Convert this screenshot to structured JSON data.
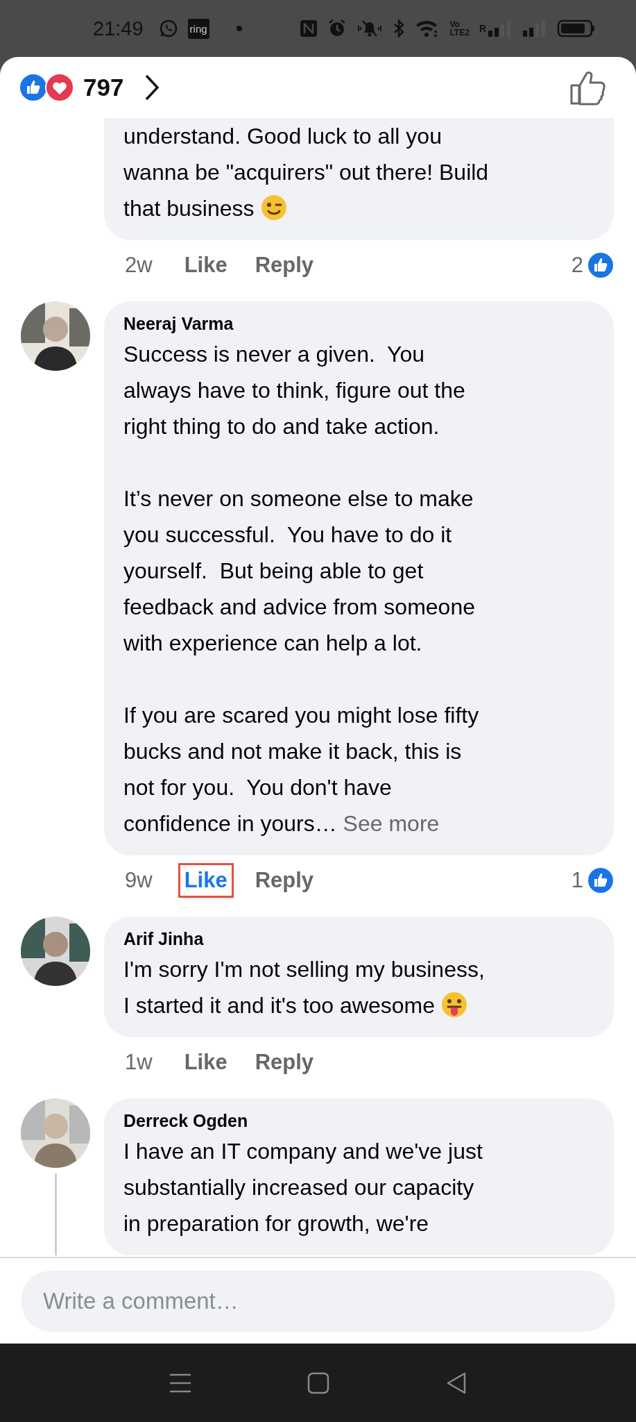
{
  "status_bar": {
    "time": "21:49",
    "app_label": "ring",
    "volte_top": "Vo",
    "volte_bottom": "LTE2",
    "roaming": "R"
  },
  "reactions": {
    "count": "797"
  },
  "comments": [
    {
      "kind": "partial",
      "paragraphs": [
        "understand. Good luck to all you\nwanna be \"acquirers\" out there! Build\nthat business"
      ],
      "emoji": {
        "kind": "wink"
      },
      "time": "2w",
      "like": {
        "label": "Like",
        "liked": false,
        "highlighted": false
      },
      "reply": "Reply",
      "reaction_count": "2"
    },
    {
      "kind": "full",
      "author": "Neeraj Varma",
      "paragraphs": [
        "Success is never a given.  You\nalways have to think, figure out the\nright thing to do and take action.",
        "It’s never on someone else to make\nyou successful.  You have to do it\nyourself.  But being able to get\nfeedback and advice from someone\nwith experience can help a lot.",
        "If you are scared you might lose fifty\nbucks and not make it back, this is\nnot for you.  You don't have\nconfidence in yours… "
      ],
      "see_more": "See more",
      "time": "9w",
      "like": {
        "label": "Like",
        "liked": true,
        "highlighted": true
      },
      "reply": "Reply",
      "reaction_count": "1"
    },
    {
      "kind": "full",
      "author": "Arif Jinha",
      "paragraphs": [
        "I'm sorry I'm not selling my business,\nI started it and it's too awesome"
      ],
      "emoji": {
        "kind": "tongue"
      },
      "time": "1w",
      "like": {
        "label": "Like",
        "liked": false,
        "highlighted": false
      },
      "reply": "Reply"
    },
    {
      "kind": "full",
      "author": "Derreck Ogden",
      "paragraphs": [
        "I have an IT company and we've just\nsubstantially increased our capacity\nin preparation for growth, we're"
      ],
      "has_replies": true
    }
  ],
  "composer": {
    "placeholder": "Write a comment…"
  }
}
